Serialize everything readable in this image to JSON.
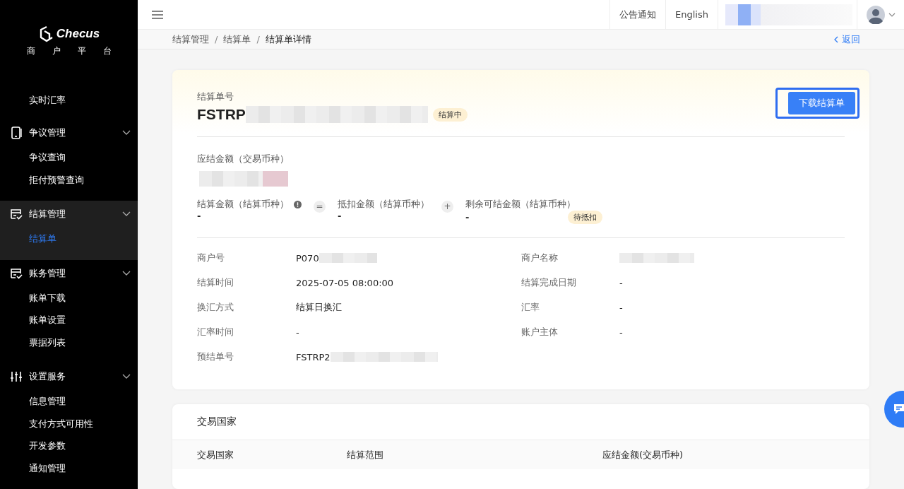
{
  "sidebar": {
    "logo": "Checus",
    "subtitle": "商户平台",
    "groups": [
      {
        "children": [
          {
            "label": "实时汇率",
            "selected": false
          }
        ]
      },
      {
        "label": "争议管理",
        "expanded": true,
        "selected": false,
        "children": [
          {
            "label": "争议查询",
            "selected": false
          },
          {
            "label": "拒付预警查询",
            "selected": false
          }
        ]
      },
      {
        "label": "结算管理",
        "expanded": true,
        "selected": true,
        "children": [
          {
            "label": "结算单",
            "selected": true
          }
        ]
      },
      {
        "label": "账务管理",
        "expanded": true,
        "selected": false,
        "children": [
          {
            "label": "账单下载",
            "selected": false
          },
          {
            "label": "账单设置",
            "selected": false
          },
          {
            "label": "票据列表",
            "selected": false
          }
        ]
      },
      {
        "label": "设置服务",
        "expanded": true,
        "selected": false,
        "children": [
          {
            "label": "信息管理",
            "selected": false
          },
          {
            "label": "支付方式可用性",
            "selected": false
          },
          {
            "label": "开发参数",
            "selected": false
          },
          {
            "label": "通知管理",
            "selected": false
          }
        ]
      }
    ]
  },
  "header": {
    "links": [
      "公告通知",
      "English"
    ]
  },
  "breadcrumb": {
    "items": [
      "结算管理",
      "结算单",
      "结算单详情"
    ],
    "separator": "/",
    "back": "返回"
  },
  "summary": {
    "id_label": "结算单号",
    "id_prefix": "FSTRP",
    "status": "结算中",
    "download_button": {
      "label": "下载结算单",
      "focused": true
    },
    "amount_label": "应结金额（交易币种）",
    "formula": [
      {
        "kind": "hinted",
        "label": "结算金额（结算币种）",
        "value": "-"
      },
      {
        "kind": "operator",
        "symbol": "="
      },
      {
        "kind": "term",
        "label": "抵扣金额（结算币种）",
        "value": "-"
      },
      {
        "kind": "operator",
        "symbol": "+"
      },
      {
        "kind": "term",
        "label": "剩余可结金额（结算币种）",
        "value": "-",
        "tag": "待抵扣"
      }
    ],
    "details": [
      {
        "kind": "masked",
        "label": "商户号",
        "value": "P070"
      },
      {
        "kind": "masked",
        "label": "商户名称"
      },
      {
        "kind": "text",
        "label": "结算时间",
        "value": "2025-07-05 08:00:00"
      },
      {
        "kind": "text",
        "label": "结算完成日期",
        "value": "-"
      },
      {
        "kind": "text",
        "label": "换汇方式",
        "value": "结算日换汇"
      },
      {
        "kind": "text",
        "label": "汇率",
        "value": "-"
      },
      {
        "kind": "text",
        "label": "汇率时间",
        "value": "-"
      },
      {
        "kind": "text",
        "label": "账户主体",
        "value": "-"
      },
      {
        "kind": "masked",
        "label": "预结单号",
        "value": "FSTRP2"
      }
    ]
  },
  "countries": {
    "title": "交易国家",
    "table": {
      "columns": [
        "交易国家",
        "结算范围",
        "应结金额(交易币种)"
      ]
    }
  }
}
